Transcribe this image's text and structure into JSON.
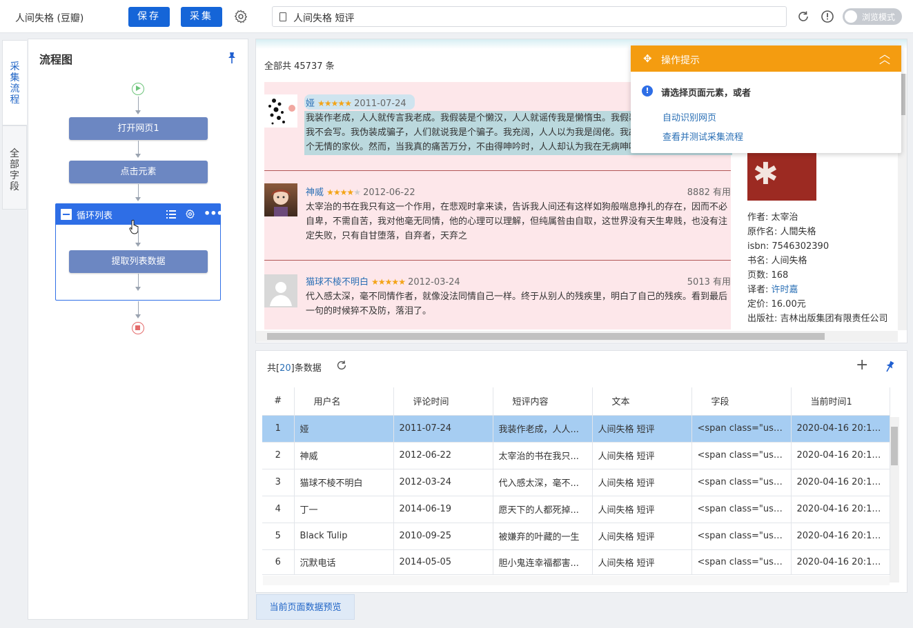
{
  "app": {
    "title": "人间失格 (豆瓣)",
    "save_label": "保存",
    "collect_label": "采集",
    "url_text": "人间失格 短评",
    "browse_mode_label": "浏览模式",
    "accent": "#1565d8"
  },
  "side_tabs": [
    {
      "label": "采集流程"
    },
    {
      "label": "全部字段"
    }
  ],
  "flow": {
    "title": "流程图",
    "nodes": {
      "open_page": "打开网页1",
      "click_element": "点击元素",
      "loop_list": "循环列表",
      "extract_list": "提取列表数据"
    }
  },
  "preview": {
    "total_label": "全部共 45737 条",
    "reviews": [
      {
        "user": "娅",
        "stars": 5,
        "date": "2011-07-24",
        "useful": "",
        "text": "我装作老成，人人就传言我老成。我假装是个懒汉，人人就谣传我是懒惰虫。我假装不会写小说，人人就传我不会写。我伪装成骗子，人们就说我是个骗子。我充阔，人人以为我是阔佬。我故作冷淡，人人就说我是个无情的家伙。然而，当我真的痛苦万分，不由得呻吟时，人人却认为我在无病呻吟。"
      },
      {
        "user": "神威",
        "stars": 4,
        "date": "2012-06-22",
        "useful": "8882 有用",
        "text": "太宰治的书在我只有这一个作用，在悲观时拿来读，告诉我人间还有这样如狗般喘息挣扎的存在，因而不必自卑，不需自苦，我对他毫无同情，他的心理可以理解，但纯属咎由自取，这世界没有天生卑贱，也没有注定失败，只有自甘堕落，自弃者，天弃之"
      },
      {
        "user": "猫球不棱不明白",
        "stars": 5,
        "date": "2012-03-24",
        "useful": "5013 有用",
        "text": "代入感太深，毫不同情作者，就像没法同情自己一样。终于从别人的残疾里，明白了自己的残疾。看到最后一句的时候猝不及防，落泪了。"
      }
    ],
    "book": {
      "author_label": "作者: ",
      "author": "太宰治",
      "original_label": "原作名: 人間失格",
      "isbn": "isbn: 7546302390",
      "book_name": "书名: 人间失格",
      "pages": "页数: 168",
      "translator_label": "译者: ",
      "translator": "许时嘉",
      "price": "定价: 16.00元",
      "publisher": "出版社: 吉林出版集团有限责任公司"
    },
    "tip": {
      "title": "操作提示",
      "message": "请选择页面元素，或者",
      "link1": "自动识别网页",
      "link2": "查看并测试采集流程"
    }
  },
  "data_panel": {
    "count_prefix": "共[",
    "count": "20",
    "count_suffix": "]条数据",
    "columns": [
      "#",
      "用户名",
      "评论时间",
      "短评内容",
      "文本",
      "字段",
      "当前时间1"
    ],
    "rows": [
      [
        "1",
        "娅",
        "2011-07-24",
        "我装作老成，人人...",
        "人间失格 短评",
        "<span class=\"user...",
        "2020-04-16 20:19:..."
      ],
      [
        "2",
        "神威",
        "2012-06-22",
        "太宰治的书在我只...",
        "人间失格 短评",
        "<span class=\"user...",
        "2020-04-16 20:19:..."
      ],
      [
        "3",
        "猫球不棱不明白",
        "2012-03-24",
        "代入感太深，毫不...",
        "人间失格 短评",
        "<span class=\"user...",
        "2020-04-16 20:19:..."
      ],
      [
        "4",
        "丁一",
        "2014-06-19",
        "愿天下的人都死掉...",
        "人间失格 短评",
        "<span class=\"user...",
        "2020-04-16 20:19:..."
      ],
      [
        "5",
        "Black Tulip",
        "2010-09-25",
        "被嫌弃的叶藏的一生",
        "人间失格 短评",
        "<span class=\"user...",
        "2020-04-16 20:19:..."
      ],
      [
        "6",
        "沉默电话",
        "2014-05-05",
        "胆小鬼连幸福都害...",
        "人间失格 短评",
        "<span class=\"user...",
        "2020-04-16 20:19:..."
      ]
    ],
    "footer_tab": "当前页面数据预览"
  }
}
